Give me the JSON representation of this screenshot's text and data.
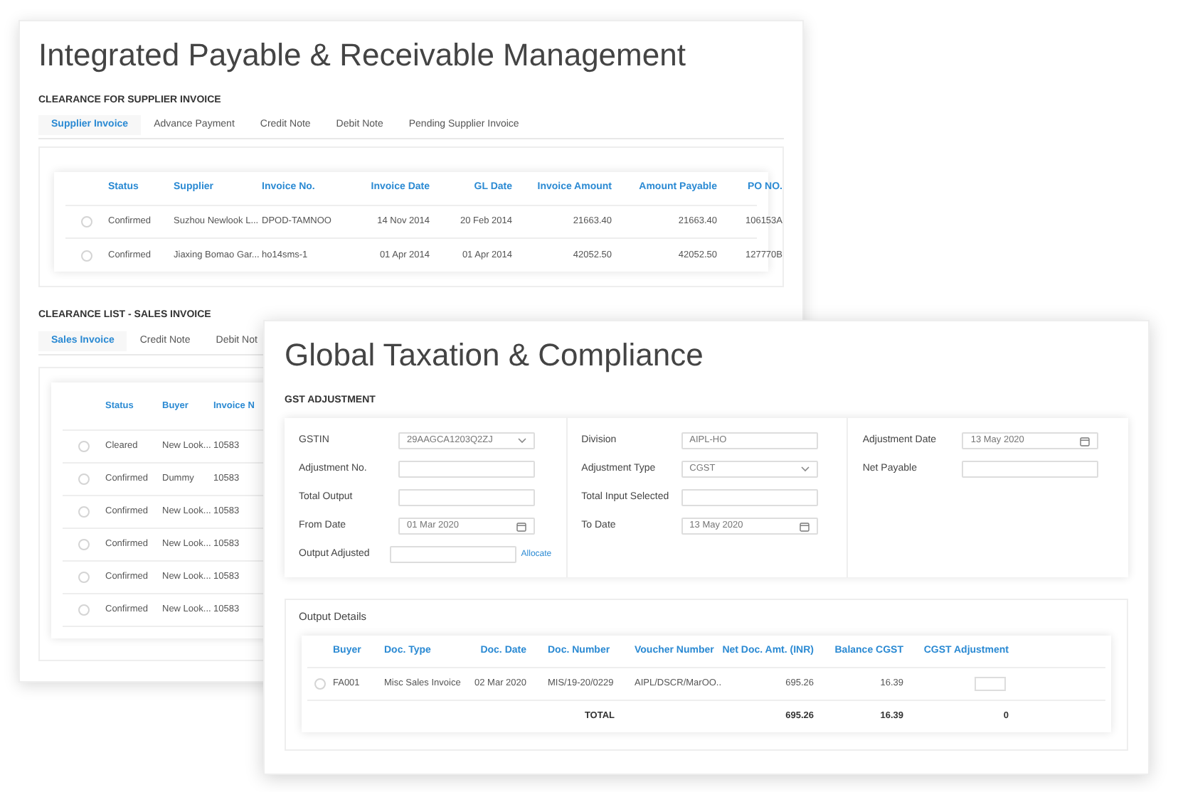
{
  "supplier_window": {
    "title": "Integrated Payable & Receivable Management",
    "supplier_section": {
      "heading": "CLEARANCE FOR SUPPLIER INVOICE",
      "tabs": [
        {
          "label": "Supplier Invoice",
          "selected": true
        },
        {
          "label": "Advance Payment",
          "selected": false
        },
        {
          "label": "Credit Note",
          "selected": false
        },
        {
          "label": "Debit Note",
          "selected": false
        },
        {
          "label": "Pending Supplier Invoice",
          "selected": false
        }
      ],
      "table": {
        "columns": [
          "Status",
          "Supplier",
          "Invoice No.",
          "Invoice Date",
          "GL Date",
          "Invoice Amount",
          "Amount Payable",
          "PO NO."
        ],
        "rows": [
          {
            "selected": false,
            "cells": [
              "Confirmed",
              "Suzhou Newlook L...",
              "DPOD-TAMNOO",
              "14 Nov 2014",
              "20 Feb 2014",
              "21663.40",
              "21663.40",
              "106153A"
            ]
          },
          {
            "selected": false,
            "cells": [
              "Confirmed",
              "Jiaxing Bomao Gar...",
              "ho14sms-1",
              "01 Apr 2014",
              "01 Apr 2014",
              "42052.50",
              "42052.50",
              "127770B"
            ]
          }
        ]
      }
    },
    "sales_section": {
      "heading": "CLEARANCE LIST - SALES INVOICE",
      "tabs": [
        {
          "label": "Sales Invoice",
          "selected": true
        },
        {
          "label": "Credit Note",
          "selected": false
        },
        {
          "label": "Debit Not",
          "selected": false
        }
      ],
      "table": {
        "columns": [
          "Status",
          "Buyer",
          "Invoice N"
        ],
        "rows": [
          {
            "selected": false,
            "cells": [
              "Cleared",
              "New Look...",
              "10583"
            ]
          },
          {
            "selected": false,
            "cells": [
              "Confirmed",
              "Dummy",
              "10583"
            ]
          },
          {
            "selected": false,
            "cells": [
              "Confirmed",
              "New Look...",
              "10583"
            ]
          },
          {
            "selected": false,
            "cells": [
              "Confirmed",
              "New Look...",
              "10583"
            ]
          },
          {
            "selected": false,
            "cells": [
              "Confirmed",
              "New Look...",
              "10583"
            ]
          },
          {
            "selected": false,
            "cells": [
              "Confirmed",
              "New Look...",
              "10583"
            ]
          }
        ]
      }
    }
  },
  "tax_window": {
    "title": "Global Taxation & Compliance",
    "gst_adjustment": {
      "heading": "GST ADJUSTMENT",
      "field_columns": [
        [
          {
            "label": "GSTIN",
            "kind": "select",
            "value": "29AAGCA1203Q2ZJ"
          },
          {
            "label": "Adjustment No.",
            "kind": "text"
          },
          {
            "label": "Total Output",
            "kind": "text"
          },
          {
            "label": "From Date",
            "kind": "date",
            "value": "01 Mar 2020"
          },
          {
            "label": "Output Adjusted",
            "kind": "text",
            "link": "Allocate"
          }
        ],
        [
          {
            "label": "Division",
            "kind": "text",
            "value": "AIPL-HO"
          },
          {
            "label": "Adjustment Type",
            "kind": "select",
            "value": "CGST"
          },
          {
            "label": "Total Input Selected",
            "kind": "text"
          },
          {
            "label": "To Date",
            "kind": "date",
            "value": "13 May 2020"
          }
        ],
        [
          {
            "label": "Adjustment Date",
            "kind": "date",
            "value": "13 May 2020"
          },
          {
            "label": "Net Payable",
            "kind": "text"
          }
        ]
      ]
    },
    "output_details": {
      "heading": "Output Details",
      "columns": [
        "Buyer",
        "Doc. Type",
        "Doc. Date",
        "Doc. Number",
        "Voucher Number",
        "Net Doc. Amt. (INR)",
        "Balance CGST",
        "CGST Adjustment"
      ],
      "rows": [
        {
          "selected": false,
          "cells": [
            "FA001",
            "Misc Sales Invoice",
            "02 Mar 2020",
            "MIS/19-20/0229",
            "AIPL/DSCR/MarOO..",
            "695.26",
            "16.39"
          ]
        }
      ],
      "total": {
        "label": "TOTAL",
        "net_amount": "695.26",
        "balance_cgst": "16.39",
        "cgst_adjustment": "0"
      }
    }
  }
}
